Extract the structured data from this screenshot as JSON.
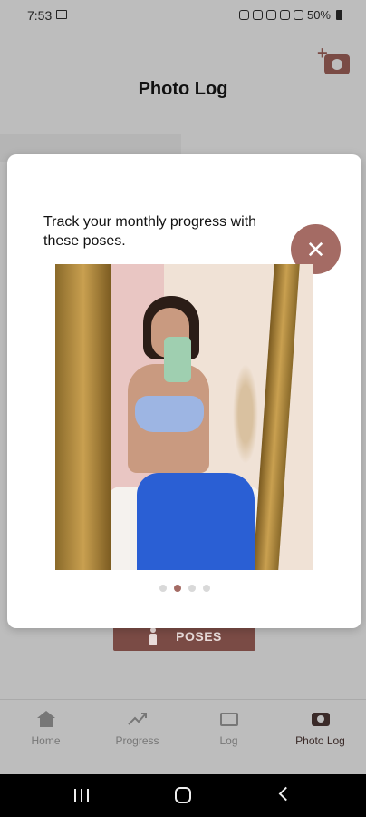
{
  "status_bar": {
    "time": "7:53",
    "battery": "50%"
  },
  "header": {
    "title": "Photo Log"
  },
  "poses_button": {
    "label": "POSES"
  },
  "modal": {
    "text": "Track your monthly progress with these poses.",
    "close_symbol": "✕",
    "dots": {
      "count": 4,
      "active_index": 1
    }
  },
  "bottom_nav": {
    "items": [
      {
        "label": "Home",
        "icon": "home-icon"
      },
      {
        "label": "Progress",
        "icon": "progress-icon"
      },
      {
        "label": "Log",
        "icon": "folder-icon"
      },
      {
        "label": "Photo Log",
        "icon": "camera-icon",
        "active": true
      }
    ]
  },
  "colors": {
    "accent": "#a46b64",
    "brand_dark": "#7a4b45",
    "overlay": "#bdbdbd"
  }
}
